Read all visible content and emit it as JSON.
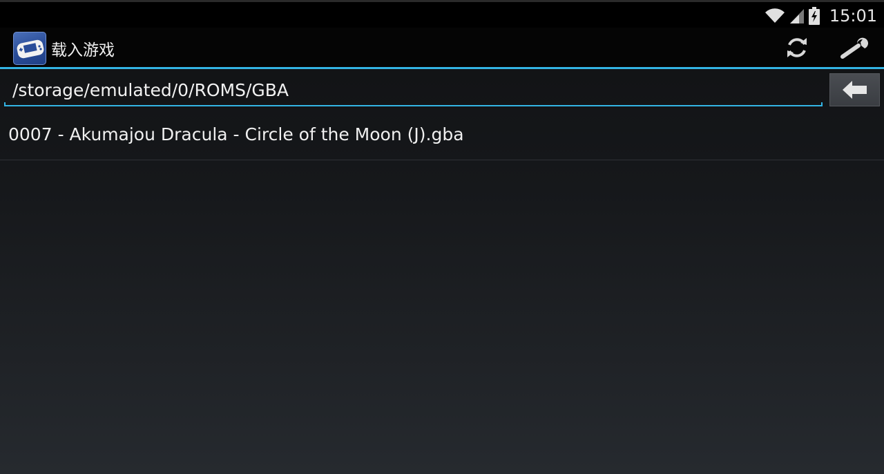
{
  "status_bar": {
    "time": "15:01",
    "icons": [
      "wifi-icon",
      "signal-icon",
      "battery-charging-icon"
    ]
  },
  "action_bar": {
    "title": "载入游戏",
    "app_icon": "gba-emulator-app-icon",
    "actions": [
      {
        "name": "refresh-icon"
      },
      {
        "name": "wrench-settings-icon"
      }
    ]
  },
  "path_bar": {
    "path": "/storage/emulated/0/ROMS/GBA",
    "back_icon": "back-arrow-icon"
  },
  "files": [
    {
      "name": "0007 - Akumajou Dracula - Circle of the Moon (J).gba"
    }
  ],
  "colors": {
    "accent": "#33b5e5",
    "background": "#16181b",
    "action_bar": "#050505"
  }
}
